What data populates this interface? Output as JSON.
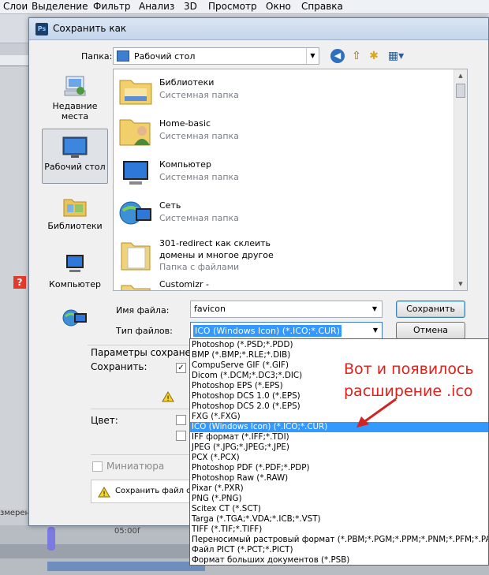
{
  "ps": {
    "menu": [
      "Слои",
      "Выделение",
      "Фильтр",
      "Анализ",
      "3D",
      "Просмотр",
      "Окно",
      "Справка"
    ],
    "status_text": "змеренв",
    "timeline_label": "05:00f"
  },
  "dialog": {
    "title": "Сохранить как",
    "title_icon": "Ps",
    "folder_label": "Папка:",
    "folder_value": "Рабочий стол"
  },
  "places": [
    {
      "label": "Недавние места",
      "icon": "recent-places-icon"
    },
    {
      "label": "Рабочий стол",
      "icon": "desktop-icon"
    },
    {
      "label": "Библиотеки",
      "icon": "libraries-icon"
    },
    {
      "label": "Компьютер",
      "icon": "computer-icon"
    },
    {
      "label": "",
      "icon": "network-icon"
    }
  ],
  "files": [
    {
      "name": "Библиотеки",
      "type": "Системная папка",
      "icon": "libraries-folder-icon"
    },
    {
      "name": "Home-basic",
      "type": "Системная папка",
      "icon": "user-folder-icon"
    },
    {
      "name": "Компьютер",
      "type": "Системная папка",
      "icon": "computer-icon"
    },
    {
      "name": "Сеть",
      "type": "Системная папка",
      "icon": "network-icon"
    },
    {
      "name": "301-redirect как склеить",
      "name2": "домены и многое другое",
      "type": "Папка с файлами",
      "icon": "folder-icon"
    },
    {
      "name": "Customizr -",
      "type": "",
      "icon": "folder-icon"
    }
  ],
  "form": {
    "filename_label": "Имя файла:",
    "filename_value": "favicon",
    "filetype_label": "Тип файлов:",
    "filetype_value": "ICO (Windows Icon) (*.ICO;*.CUR)",
    "save_button": "Сохранить",
    "cancel_button": "Отмена"
  },
  "options": {
    "title": "Параметры сохранения",
    "save_label": "Сохранить:",
    "color_label": "Цвет:",
    "thumbnail_label": "Миниатюра",
    "note_text": "Сохранить файл с"
  },
  "filetypes": [
    "Photoshop (*.PSD;*.PDD)",
    "BMP (*.BMP;*.RLE;*.DIB)",
    "CompuServe GIF (*.GIF)",
    "Dicom (*.DCM;*.DC3;*.DIC)",
    "Photoshop EPS (*.EPS)",
    "Photoshop DCS 1.0 (*.EPS)",
    "Photoshop DCS 2.0 (*.EPS)",
    "FXG (*.FXG)",
    "ICO (Windows Icon) (*.ICO;*.CUR)",
    "IFF формат (*.IFF;*.TDI)",
    "JPEG (*.JPG;*.JPEG;*.JPE)",
    "PCX (*.PCX)",
    "Photoshop PDF (*.PDF;*.PDP)",
    "Photoshop Raw (*.RAW)",
    "Pixar (*.PXR)",
    "PNG (*.PNG)",
    "Scitex CT (*.SCT)",
    "Targa (*.TGA;*.VDA;*.ICB;*.VST)",
    "TIFF (*.TIF;*.TIFF)",
    "Переносимый растровый формат (*.PBM;*.PGM;*.PPM;*.PNM;*.PFM;*.PAM)",
    "Файл PICT (*.PCT;*.PICT)",
    "Формат больших документов (*.PSB)"
  ],
  "selected_filetype_index": 8,
  "annotation": {
    "line1": "Вот и появилось",
    "line2": "расширение .ico",
    "color": "#e0201b"
  }
}
